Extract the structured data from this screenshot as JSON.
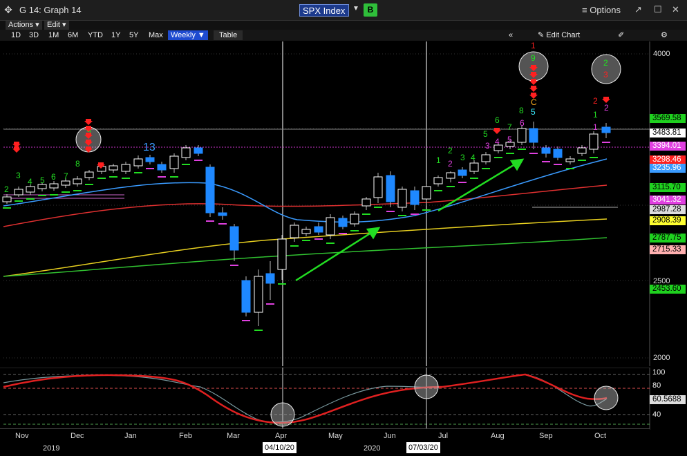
{
  "window": {
    "title": "G 14: Graph 14",
    "ticker": "SPX Index",
    "ticker_button": "B",
    "options_label": "Options"
  },
  "menus": {
    "actions": "Actions",
    "edit": "Edit"
  },
  "toolbar": {
    "ranges": [
      "1D",
      "3D",
      "1M",
      "6M",
      "YTD",
      "1Y",
      "5Y",
      "Max"
    ],
    "period": "Weekly",
    "table": "Table",
    "edit_chart": "Edit Chart"
  },
  "price_axis": {
    "ticks": [
      "4000",
      "2500",
      "2000"
    ]
  },
  "price_labels": [
    {
      "value": "3569.58",
      "bg": "#1fd11f",
      "fg": "#000"
    },
    {
      "value": "3483.81",
      "bg": "#ffffff",
      "fg": "#000"
    },
    {
      "value": "3394.01",
      "bg": "#e040e0",
      "fg": "#fff"
    },
    {
      "value": "3298.46",
      "bg": "#ff2020",
      "fg": "#fff"
    },
    {
      "value": "3235.96",
      "bg": "#3a9bff",
      "fg": "#fff"
    },
    {
      "value": "3115.70",
      "bg": "#1fd11f",
      "fg": "#000"
    },
    {
      "value": "3041.32",
      "bg": "#e040e0",
      "fg": "#fff"
    },
    {
      "value": "2987.28",
      "bg": "#dddddd",
      "fg": "#000"
    },
    {
      "value": "2908.39",
      "bg": "#ffff30",
      "fg": "#000"
    },
    {
      "value": "2787.75",
      "bg": "#1fd11f",
      "fg": "#000"
    },
    {
      "value": "2715.33",
      "bg": "#ffb0b0",
      "fg": "#000"
    },
    {
      "value": "2453.60",
      "bg": "#1fd11f",
      "fg": "#000"
    }
  ],
  "osc_axis": {
    "ticks": [
      "100",
      "80",
      "40"
    ],
    "current": "60.5688"
  },
  "x_axis": {
    "months": [
      "Nov",
      "Dec",
      "Jan",
      "Feb",
      "Mar",
      "Apr",
      "May",
      "Jun",
      "Jul",
      "Aug",
      "Sep",
      "Oct"
    ],
    "years": [
      "2019",
      "2020"
    ],
    "markers": [
      "04/10/20",
      "07/03/20"
    ]
  },
  "annotations": {
    "count_13": "13",
    "c_label": "C"
  },
  "colors": {
    "up": "#ffffff",
    "down": "#1e88ff",
    "ma_blue": "#3a9bff",
    "ma_red": "#e03030",
    "ma_yellow": "#e8d020",
    "ma_green": "#30c030",
    "count_green": "#22dd22",
    "count_magenta": "#e040e0",
    "count_red": "#ff2020",
    "osc_red": "#e02020"
  }
}
